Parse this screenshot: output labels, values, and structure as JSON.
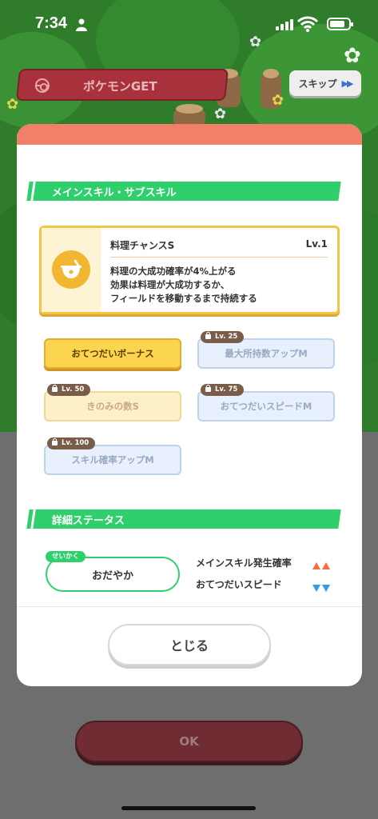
{
  "status_bar": {
    "time": "7:34"
  },
  "header": {
    "banner_label": "ポケモンGET",
    "skip_label": "スキップ"
  },
  "modal": {
    "main_section_title": "メインスキル・サブスキル",
    "main_skill": {
      "name": "料理チャンスS",
      "level": "Lv.1",
      "description": [
        "料理の大成功確率が4%上がる",
        "効果は料理が大成功するか、",
        "フィールドを移動するまで持続する"
      ]
    },
    "sub_skills": [
      {
        "label": "おてつだいボーナス",
        "lock": ""
      },
      {
        "label": "最大所持数アップM",
        "lock": "Lv. 25"
      },
      {
        "label": "きのみの数S",
        "lock": "Lv. 50"
      },
      {
        "label": "おてつだいスピードM",
        "lock": "Lv. 75"
      },
      {
        "label": "スキル確率アップM",
        "lock": "Lv. 100"
      }
    ],
    "detail_section_title": "詳細ステータス",
    "nature": {
      "tag": "せいかく",
      "value": "おだやか"
    },
    "stats": [
      {
        "label": "メインスキル発生確率",
        "direction": "up"
      },
      {
        "label": "おてつだいスピード",
        "direction": "down"
      }
    ],
    "close_label": "とじる"
  },
  "footer": {
    "ok_label": "OK"
  },
  "colors": {
    "accent_green": "#2fd06b",
    "modal_top": "#f27f67",
    "gold": "#fbd54e",
    "up_arrow": "#ff6a3d",
    "down_arrow": "#2d9fe6"
  }
}
